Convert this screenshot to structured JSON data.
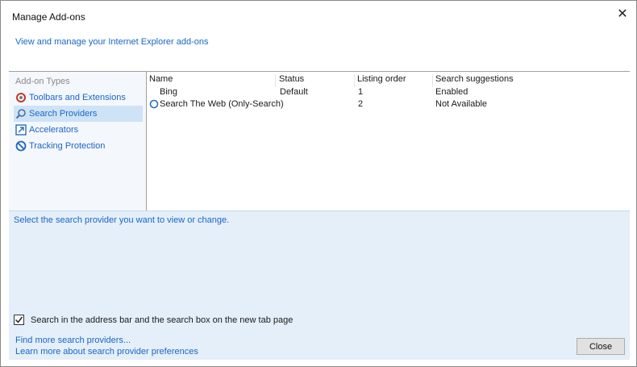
{
  "window": {
    "title": "Manage Add-ons",
    "subtitle": "View and manage your Internet Explorer add-ons"
  },
  "sidebar": {
    "heading": "Add-on Types",
    "items": [
      {
        "label": "Toolbars and Extensions",
        "icon": "gear-icon"
      },
      {
        "label": "Search Providers",
        "icon": "search-icon",
        "selected": true
      },
      {
        "label": "Accelerators",
        "icon": "accelerator-icon"
      },
      {
        "label": "Tracking Protection",
        "icon": "block-icon"
      }
    ]
  },
  "list": {
    "columns": [
      "Name",
      "Status",
      "Listing order",
      "Search suggestions"
    ],
    "rows": [
      {
        "name": "Bing",
        "status": "Default",
        "order": "1",
        "suggestions": "Enabled"
      },
      {
        "name": "Search The Web (Only-Search)",
        "status": "",
        "order": "2",
        "suggestions": "Not Available"
      }
    ]
  },
  "details": {
    "hint": "Select the search provider you want to view or change.",
    "checkbox_label": "Search in the address bar and the search box on the new tab page",
    "checkbox_checked": true,
    "link_find": "Find more search providers...",
    "link_learn": "Learn more about search provider preferences",
    "close_label": "Close"
  },
  "colors": {
    "accent": "#1a66c7",
    "selected_bg": "#cfe3f7",
    "details_bg": "#e4eff9"
  }
}
